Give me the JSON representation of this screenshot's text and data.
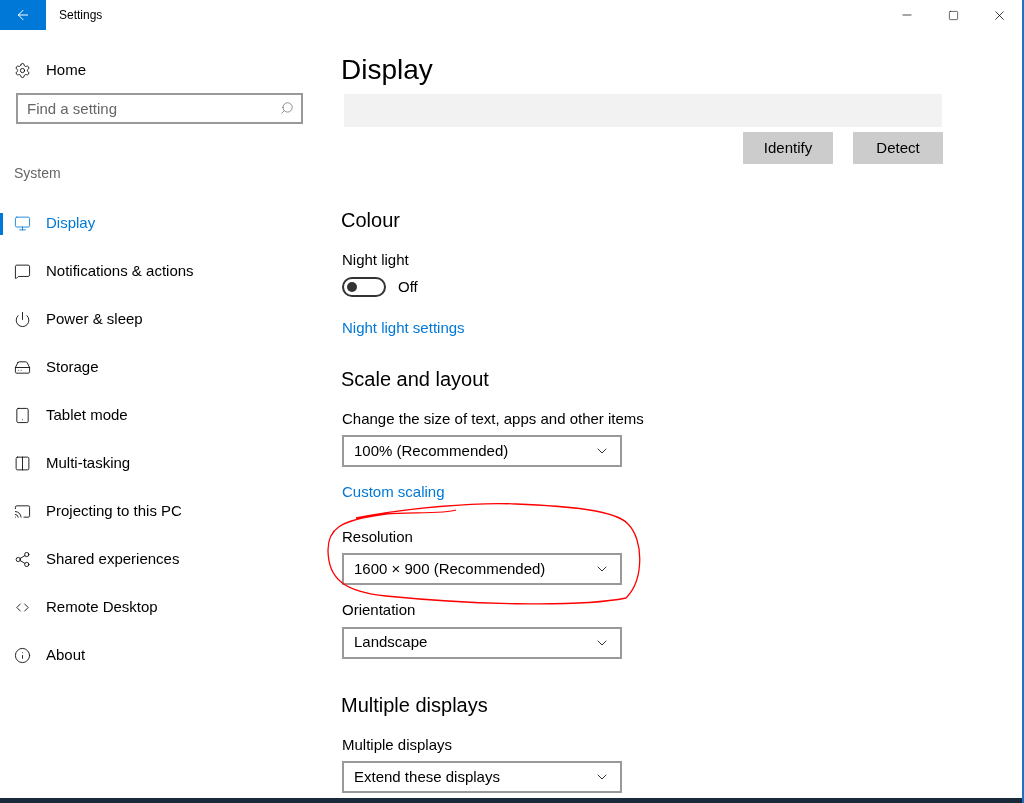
{
  "window": {
    "title": "Settings"
  },
  "sidebar": {
    "home": "Home",
    "search": {
      "placeholder": "Find a setting"
    },
    "section": "System",
    "items": [
      {
        "label": "Display",
        "selected": true
      },
      {
        "label": "Notifications & actions",
        "selected": false
      },
      {
        "label": "Power & sleep",
        "selected": false
      },
      {
        "label": "Storage",
        "selected": false
      },
      {
        "label": "Tablet mode",
        "selected": false
      },
      {
        "label": "Multi-tasking",
        "selected": false
      },
      {
        "label": "Projecting to this PC",
        "selected": false
      },
      {
        "label": "Shared experiences",
        "selected": false
      },
      {
        "label": "Remote Desktop",
        "selected": false
      },
      {
        "label": "About",
        "selected": false
      }
    ]
  },
  "content": {
    "title": "Display",
    "buttons": [
      "Identify",
      "Detect"
    ],
    "colour": {
      "heading": "Colour",
      "night_light": {
        "label": "Night light",
        "on": false,
        "state": "Off"
      },
      "link": "Night light settings"
    },
    "scale": {
      "heading": "Scale and layout",
      "size_label": "Change the size of text, apps and other items",
      "size_value": "100% (Recommended)",
      "link": "Custom scaling",
      "resolution_label": "Resolution",
      "resolution_value": "1600 × 900 (Recommended)",
      "orientation_label": "Orientation",
      "orientation_value": "Landscape"
    },
    "multiple": {
      "heading": "Multiple displays",
      "label": "Multiple displays",
      "value": "Extend these displays"
    }
  }
}
